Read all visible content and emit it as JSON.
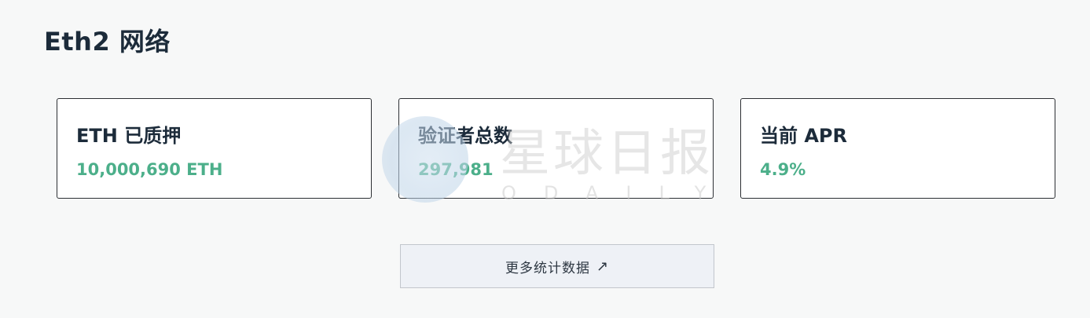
{
  "page": {
    "title": "Eth2 网络"
  },
  "cards": [
    {
      "label": "ETH 已质押",
      "value": "10,000,690 ETH"
    },
    {
      "label": "验证者总数",
      "value": "297,981"
    },
    {
      "label": "当前 APR",
      "value": "4.9%"
    }
  ],
  "more_button": {
    "label": "更多统计数据",
    "icon": "arrow-up-right-icon",
    "glyph": "↗"
  },
  "watermark": {
    "text_cn": "星球日报",
    "text_en": "ODAILY"
  },
  "colors": {
    "value_green": "#4caf8a",
    "title_dark": "#1c2b3a",
    "background": "#f7f8f8",
    "button_bg": "#eef1f6"
  }
}
